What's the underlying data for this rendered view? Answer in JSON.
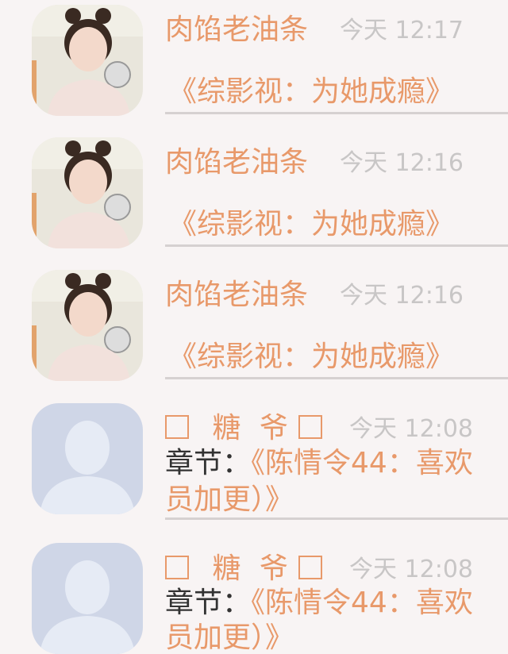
{
  "comments": [
    {
      "name": "肉馅老油条",
      "time": "今天 12:17",
      "content": "《综影视：为她成瘾》",
      "avatar": "photo"
    },
    {
      "name": "肉馅老油条",
      "time": "今天 12:16",
      "content": "《综影视：为她成瘾》",
      "avatar": "photo"
    },
    {
      "name": "肉馅老油条",
      "time": "今天 12:16",
      "content": "《综影视：为她成瘾》",
      "avatar": "photo"
    },
    {
      "name_char1": "糖",
      "name_char2": "爷",
      "time": "今天 12:08",
      "prefix": "章节：",
      "content": "《陈情令44：喜欢",
      "content2": "员加更）》",
      "avatar": "default"
    },
    {
      "name_char1": "糖",
      "name_char2": "爷",
      "time": "今天 12:08",
      "prefix": "章节：",
      "content": "《陈情令44：喜欢",
      "content2": "员加更）》",
      "avatar": "default"
    }
  ],
  "colors": {
    "accent": "#e8996a",
    "time": "#c8c6c6",
    "background": "#f8f4f4"
  }
}
